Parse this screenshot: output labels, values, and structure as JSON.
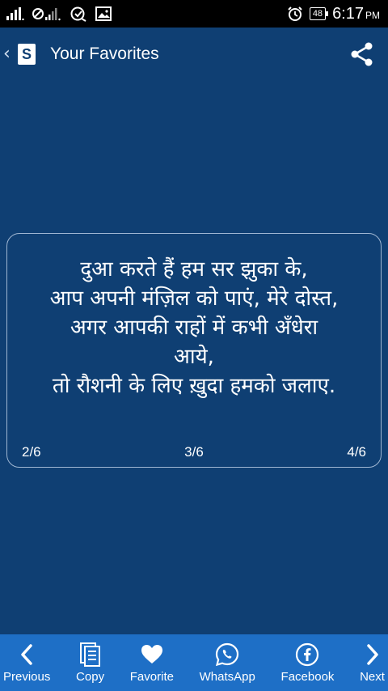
{
  "status_bar": {
    "icons": [
      "signal-icon",
      "no-signal-icon",
      "data-sync-icon",
      "image-icon"
    ],
    "battery_level": "48",
    "time": "6:17",
    "ampm": "PM"
  },
  "app_bar": {
    "logo_letter": "S",
    "title": "Your Favorites"
  },
  "quote": {
    "lines": [
      "दुआ करते हैं हम सर झुका के,",
      "आप अपनी मंज़िल को पाएं, मेरे दोस्त,",
      "अगर आपकी राहों में कभी अँधेरा",
      "आये,",
      "तो रौशनी के लिए ख़ुदा हमको जलाए."
    ],
    "prev_page": "2/6",
    "current_page": "3/6",
    "next_page": "4/6"
  },
  "bottom_bar": {
    "previous": "Previous",
    "copy": "Copy",
    "favorite": "Favorite",
    "whatsapp": "WhatsApp",
    "facebook": "Facebook",
    "next": "Next"
  },
  "colors": {
    "background": "#0f3f73",
    "bottom_bar": "#1e6fc6",
    "status_bar": "#000000"
  }
}
